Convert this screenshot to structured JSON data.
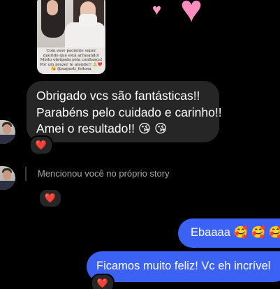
{
  "story": {
    "caption": "Com esse paciente super querido que está arrasando! Muito obrigada pela confiança! Por um prazer te atender! 🙏❤️😘 @augusti_feitosa"
  },
  "decorations": {
    "heart_glyph": "♥"
  },
  "messages": {
    "incoming": {
      "lines": [
        "Obrigado vcs são fantásticas!!",
        "Parabéns pelo cuidado e carinho!!",
        "Amei o resultado!! 😘 😘"
      ],
      "reaction": "❤️"
    },
    "mention": {
      "text": "Mencionou você no próprio story",
      "reaction": "❤️"
    },
    "outgoing": [
      {
        "text": "Ebaaaa 🥰 🥰 🥰"
      },
      {
        "text": "Ficamos muito feliz! Vc eh incrível",
        "reaction": "❤️"
      }
    ]
  },
  "colors": {
    "background": "#000000",
    "incoming_bubble": "#262626",
    "outgoing_bubble": "#3b62f5",
    "heart_pink": "#ff8cc0",
    "reaction_red": "#ff2d3d"
  }
}
